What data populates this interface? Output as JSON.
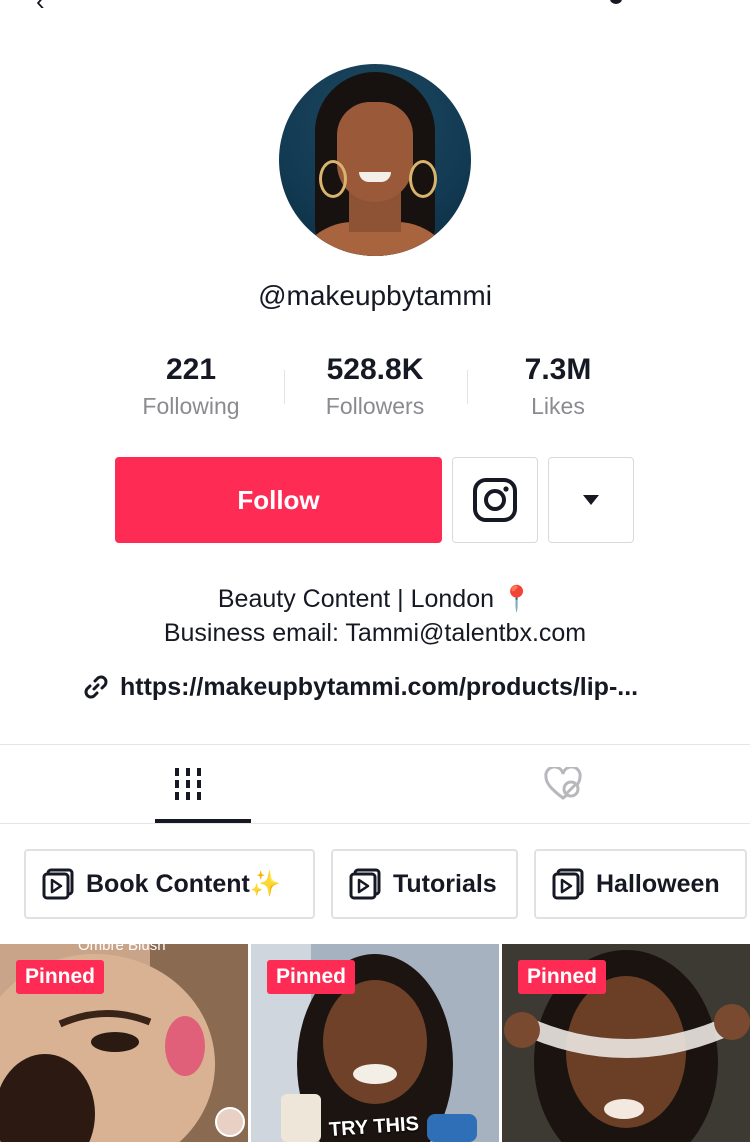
{
  "profile": {
    "username": "@makeupbytammi",
    "stats": [
      {
        "value": "221",
        "label": "Following"
      },
      {
        "value": "528.8K",
        "label": "Followers"
      },
      {
        "value": "7.3M",
        "label": "Likes"
      }
    ],
    "follow_label": "Follow",
    "bio_line1": "Beauty Content | London 📍",
    "bio_line2": "Business email: Tammi@talentbx.com",
    "link": "https://makeupbytammi.com/products/lip-..."
  },
  "playlists": [
    {
      "label": "Book Content✨"
    },
    {
      "label": "Tutorials"
    },
    {
      "label": "Halloween"
    }
  ],
  "videos": [
    {
      "badge": "Pinned",
      "caption": "Ombre Blush"
    },
    {
      "badge": "Pinned",
      "caption": "TRY THIS"
    },
    {
      "badge": "Pinned",
      "caption": ""
    }
  ],
  "colors": {
    "accent": "#fe2c55",
    "text": "#161823",
    "muted": "#8a8b91"
  }
}
